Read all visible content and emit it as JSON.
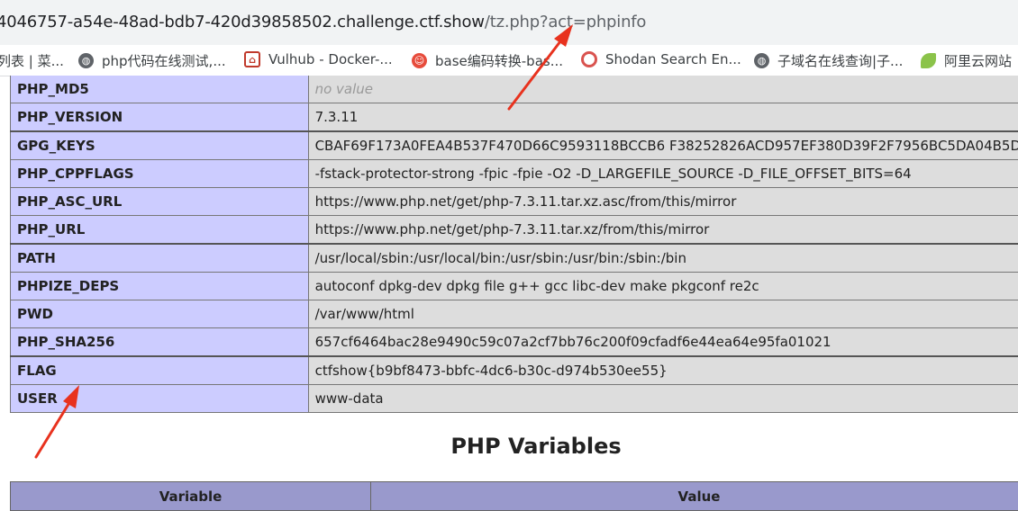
{
  "browser": {
    "url_host": "4046757-a54e-48ad-bdb7-420d39858502.challenge.ctf.show",
    "url_path": "/tz.php?act=phpinfo"
  },
  "bookmarks": [
    {
      "icon": "none",
      "label": "列表 | 菜..."
    },
    {
      "icon": "globe-icon",
      "label": "php代码在线测试,..."
    },
    {
      "icon": "vulhub-icon",
      "label": "Vulhub - Docker-..."
    },
    {
      "icon": "clown-icon",
      "label": "base编码转换-bas..."
    },
    {
      "icon": "shodan-icon",
      "label": "Shodan Search En..."
    },
    {
      "icon": "globe-icon",
      "label": "子域名在线查询|子..."
    },
    {
      "icon": "leaf-icon",
      "label": "阿里云网站"
    }
  ],
  "env_rows": [
    {
      "key": "PHP_MD5",
      "value": "no value"
    },
    {
      "key": "PHP_VERSION",
      "value": "7.3.11"
    },
    {
      "key": "GPG_KEYS",
      "value": "CBAF69F173A0FEA4B537F470D66C9593118BCCB6 F38252826ACD957EF380D39F2F7956BC5DA04B5D"
    },
    {
      "key": "PHP_CPPFLAGS",
      "value": "-fstack-protector-strong -fpic -fpie -O2 -D_LARGEFILE_SOURCE -D_FILE_OFFSET_BITS=64"
    },
    {
      "key": "PHP_ASC_URL",
      "value": "https://www.php.net/get/php-7.3.11.tar.xz.asc/from/this/mirror"
    },
    {
      "key": "PHP_URL",
      "value": "https://www.php.net/get/php-7.3.11.tar.xz/from/this/mirror"
    },
    {
      "key": "PATH",
      "value": "/usr/local/sbin:/usr/local/bin:/usr/sbin:/usr/bin:/sbin:/bin"
    },
    {
      "key": "PHPIZE_DEPS",
      "value": "autoconf dpkg-dev dpkg file g++ gcc libc-dev make pkgconf re2c"
    },
    {
      "key": "PWD",
      "value": "/var/www/html"
    },
    {
      "key": "PHP_SHA256",
      "value": "657cf6464bac28e9490c59c07a2cf7bb76c200f09cfadf6e44ea64e95fa01021"
    },
    {
      "key": "FLAG",
      "value": "ctfshow{b9bf8473-bbfc-4dc6-b30c-d974b530ee55}"
    },
    {
      "key": "USER",
      "value": "www-data"
    }
  ],
  "section_title": "PHP Variables",
  "var_table": {
    "col1": "Variable",
    "col2": "Value"
  },
  "colors": {
    "key_bg": "#ccccff",
    "value_bg": "#dddddd",
    "header_bg": "#9999cc",
    "annotation": "#e8321e"
  }
}
